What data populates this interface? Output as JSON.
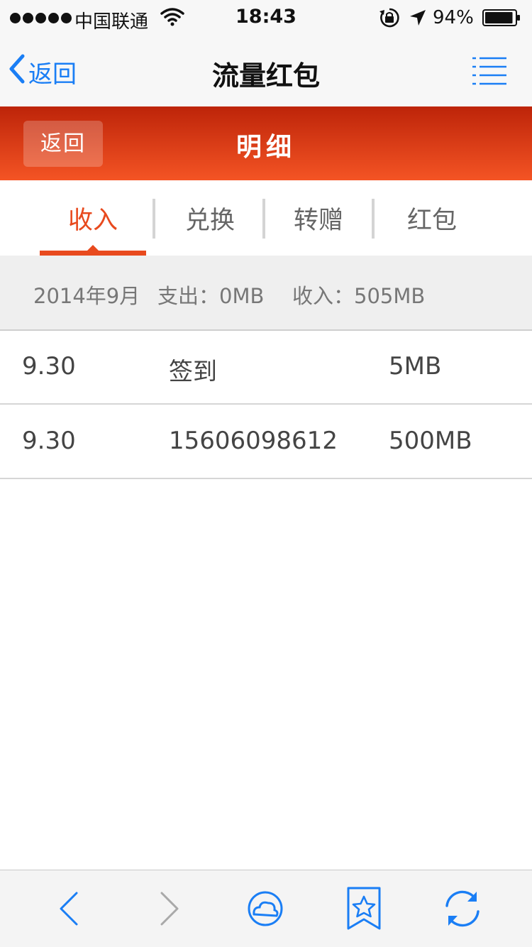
{
  "status_bar": {
    "carrier": "中国联通",
    "time": "18:43",
    "battery": "94%",
    "battery_level": 0.94,
    "icons": [
      "signal-dots-icon",
      "wifi-icon",
      "rotation-lock-icon",
      "location-arrow-icon",
      "battery-icon"
    ]
  },
  "nav": {
    "back_label": "返回",
    "title": "流量红包",
    "menu_icon": "list-menu-icon"
  },
  "header": {
    "back_label": "返回",
    "title": "明细"
  },
  "tabs": [
    {
      "label": "收入",
      "active": true
    },
    {
      "label": "兑换",
      "active": false
    },
    {
      "label": "转赠",
      "active": false
    },
    {
      "label": "红包",
      "active": false
    }
  ],
  "summary": {
    "month": "2014年9月",
    "expense": "支出：0MB",
    "income": "收入：505MB"
  },
  "records": [
    {
      "date": "9.30",
      "desc": "签到",
      "amount": "5MB"
    },
    {
      "date": "9.30",
      "desc": "15606098612",
      "amount": "500MB"
    }
  ],
  "toolbar": {
    "icons": [
      "chevron-left-icon",
      "chevron-right-icon",
      "cloud-search-icon",
      "bookmark-star-icon",
      "refresh-icon"
    ]
  },
  "colors": {
    "accent": "#e84a1e",
    "ios_blue": "#1a7ef5",
    "header_top": "#bd2409",
    "header_bottom": "#f45424"
  }
}
